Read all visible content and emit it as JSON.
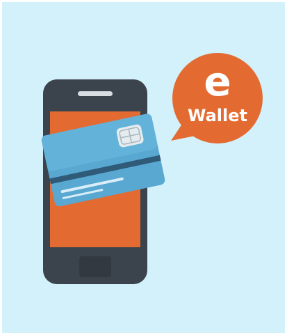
{
  "badge": {
    "letter": "e",
    "word": "Wallet"
  },
  "colors": {
    "background": "#d3f1fa",
    "phone_body": "#3b434c",
    "screen": "#e36b31",
    "card": "#58a8d1",
    "card_shade": "#4a94bd",
    "badge": "#e36b31",
    "text_on_badge": "#ffffff"
  },
  "icons": {
    "phone": "smartphone-icon",
    "card": "credit-card-icon",
    "chip": "card-chip-icon",
    "badge": "speech-bubble-icon"
  }
}
